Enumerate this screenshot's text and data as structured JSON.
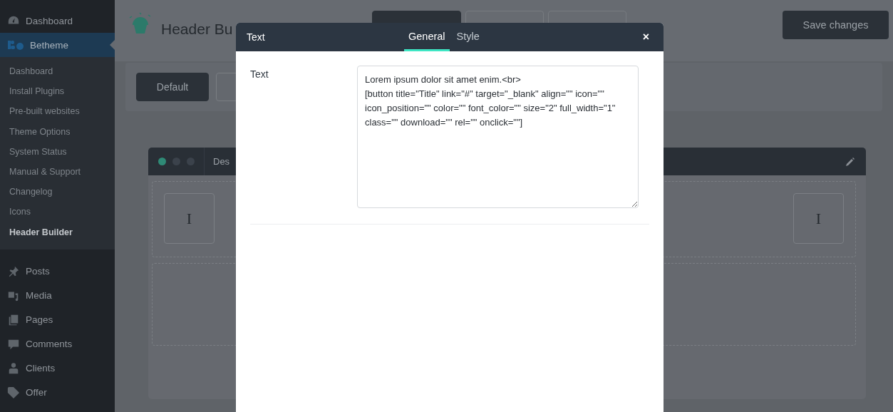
{
  "sidebar": {
    "items": [
      {
        "label": "Dashboard",
        "selected": false
      },
      {
        "label": "Betheme",
        "selected": true,
        "children": [
          {
            "label": "Dashboard",
            "selected": false
          },
          {
            "label": "Install Plugins",
            "selected": false
          },
          {
            "label": "Pre-built websites",
            "selected": false
          },
          {
            "label": "Theme Options",
            "selected": false
          },
          {
            "label": "System Status",
            "selected": false
          },
          {
            "label": "Manual & Support",
            "selected": false
          },
          {
            "label": "Changelog",
            "selected": false
          },
          {
            "label": "Icons",
            "selected": false
          },
          {
            "label": "Header Builder",
            "selected": true
          }
        ]
      },
      {
        "label": "Posts",
        "selected": false
      },
      {
        "label": "Media",
        "selected": false
      },
      {
        "label": "Pages",
        "selected": false
      },
      {
        "label": "Comments",
        "selected": false
      },
      {
        "label": "Clients",
        "selected": false
      },
      {
        "label": "Offer",
        "selected": false
      }
    ]
  },
  "page": {
    "title": "Header Bu",
    "devices": [
      {
        "selected": true
      },
      {
        "selected": false
      },
      {
        "selected": false
      }
    ],
    "save_button": "Save changes",
    "presets": [
      {
        "label": "Default",
        "selected": true
      },
      {
        "selected": false
      }
    ],
    "builder": {
      "title": "Des",
      "dots": [
        {
          "color": "#2f8a76"
        },
        {
          "color": "#3b424b"
        },
        {
          "color": "#3b424b"
        }
      ],
      "items": [
        "I",
        "I"
      ]
    }
  },
  "modal": {
    "title": "Text",
    "tabs": [
      {
        "label": "General",
        "selected": true
      },
      {
        "label": "Style",
        "selected": false
      }
    ],
    "close": "×",
    "field": {
      "label": "Text",
      "value": "Lorem ipsum dolor sit amet enim.<br>\n[button title=\"Title\" link=\"#\" target=\"_blank\" align=\"\" icon=\"\" icon_position=\"\" color=\"\" font_color=\"\" size=\"2\" full_width=\"1\" class=\"\" download=\"\" rel=\"\" onclick=\"\"]"
    }
  }
}
